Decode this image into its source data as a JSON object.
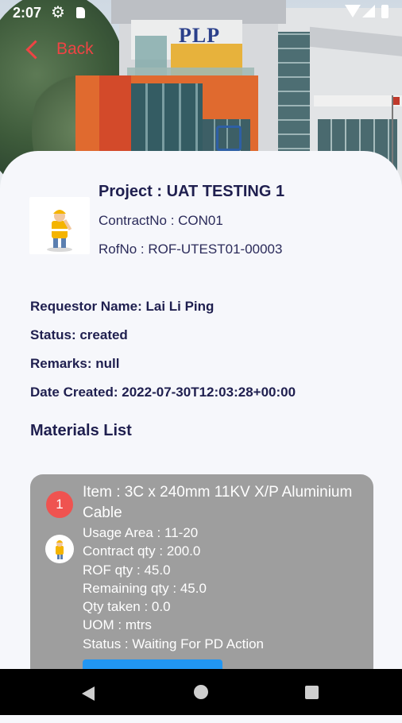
{
  "status_bar": {
    "time": "2:07"
  },
  "header": {
    "back_label": "Back",
    "building_sign": "PLP"
  },
  "project": {
    "title": "Project : UAT TESTING 1",
    "contract_no": "ContractNo : CON01",
    "rof_no": "RofNo : ROF-UTEST01-00003"
  },
  "details": {
    "requestor": "Requestor Name: Lai Li Ping",
    "status": "Status: created",
    "remarks": "Remarks: null",
    "date_created": "Date Created: 2022-07-30T12:03:28+00:00"
  },
  "materials": {
    "heading": "Materials List",
    "items": [
      {
        "index": "1",
        "item": "Item : 3C x 240mm 11KV X/P Aluminium Cable",
        "usage_area": "Usage Area : 11-20",
        "contract_qty": "Contract qty : 200.0",
        "rof_qty": "ROF qty : 45.0",
        "remaining_qty": "Remaining qty : 45.0",
        "qty_taken": "Qty taken : 0.0",
        "uom": "UOM : mtrs",
        "status": "Status : Waiting For PD Action"
      }
    ]
  },
  "colors": {
    "accent_red": "#ef4444",
    "badge_red": "#ef5350",
    "button_blue": "#2196f3",
    "card_gray": "#9e9e9e",
    "text_navy": "#1f1f4f"
  },
  "icons": [
    "settings-icon",
    "sd-card-icon",
    "wifi-icon",
    "signal-icon",
    "battery-icon",
    "back-chevron-icon",
    "worker-icon",
    "nav-back-icon",
    "nav-home-icon",
    "nav-recents-icon"
  ]
}
